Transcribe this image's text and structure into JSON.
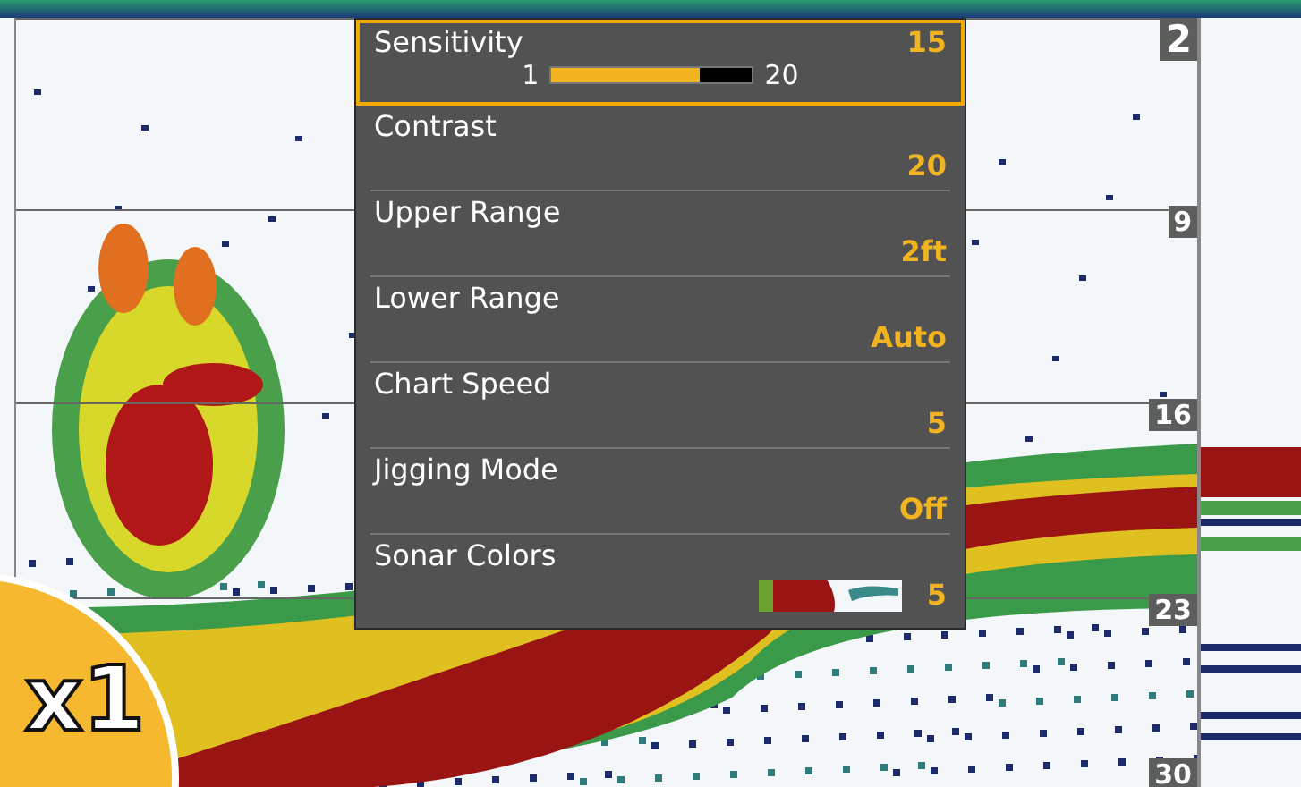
{
  "sonar": {
    "depth_labels": [
      "2",
      "9",
      "16",
      "23",
      "30"
    ]
  },
  "menu": {
    "items": [
      {
        "kind": "slider",
        "label": "Sensitivity",
        "value": "15",
        "min": "1",
        "max": "20",
        "level": 0.74,
        "selected": true
      },
      {
        "kind": "value",
        "label": "Contrast",
        "value": "20",
        "selected": false
      },
      {
        "kind": "value",
        "label": "Upper Range",
        "value": "2ft",
        "selected": false
      },
      {
        "kind": "value",
        "label": "Lower Range",
        "value": "Auto",
        "selected": false
      },
      {
        "kind": "value",
        "label": "Chart Speed",
        "value": "5",
        "selected": false
      },
      {
        "kind": "value",
        "label": "Jigging Mode",
        "value": "Off",
        "selected": false
      },
      {
        "kind": "palette",
        "label": "Sonar Colors",
        "value": "5",
        "selected": false
      }
    ]
  },
  "badge": {
    "text": "x1"
  }
}
